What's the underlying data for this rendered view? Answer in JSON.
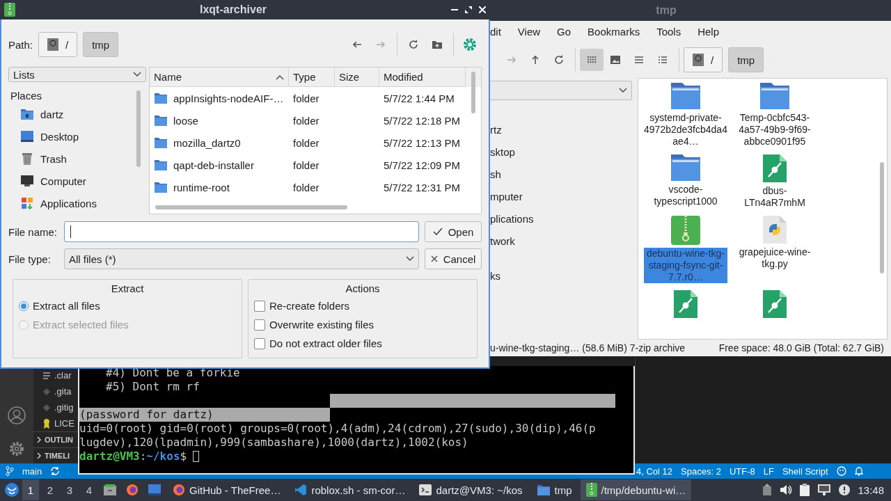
{
  "vscode": {
    "explorer": [
      {
        "label": ".clar",
        "kind": "lines"
      },
      {
        "label": ".gita",
        "kind": "git"
      },
      {
        "label": ".gitig",
        "kind": "git"
      },
      {
        "label": "LICE",
        "kind": "license"
      }
    ],
    "sections": [
      {
        "label": "OUTLIN",
        "expanded": false
      },
      {
        "label": "TIMELI",
        "expanded": false
      }
    ],
    "branch": "main",
    "status_right": [
      "4, Col 12",
      "Spaces: 2",
      "UTF-8",
      "LF",
      "Shell Script"
    ]
  },
  "file_manager": {
    "title": "tmp",
    "menu": [
      "dit",
      "View",
      "Go",
      "Bookmarks",
      "Tools",
      "Help"
    ],
    "nav": [
      {
        "kind": "forward",
        "disabled": true
      },
      {
        "kind": "up",
        "disabled": false
      },
      {
        "kind": "refresh",
        "disabled": false
      }
    ],
    "views": [
      {
        "kind": "icons",
        "selected": true
      },
      {
        "kind": "thumbnails",
        "selected": false
      },
      {
        "kind": "compact",
        "selected": false
      },
      {
        "kind": "details",
        "selected": false
      }
    ],
    "path": [
      {
        "label": "/",
        "kind": "root",
        "selected": false
      },
      {
        "label": "tmp",
        "kind": "folder",
        "selected": true
      }
    ],
    "side_items": [
      "rtz",
      "sktop",
      "sh",
      "mputer",
      "plications",
      "twork",
      "ks"
    ],
    "files": [
      {
        "name": "systemd-private-4972b2de3fcb4da4ae4…",
        "kind": "folder",
        "selected": false
      },
      {
        "name": "Temp-0cbfc543-4a57-49b9-9f69-abbce0901f95",
        "kind": "folder",
        "selected": false
      },
      {
        "name": "vscode-typescript1000",
        "kind": "folder",
        "selected": false
      },
      {
        "name": "dbus-LTn4aR7mhM",
        "kind": "link",
        "selected": false
      },
      {
        "name": "debuntu-wine-tkg-staging-fsync-git-7.7.r0…",
        "kind": "archive",
        "selected": true
      },
      {
        "name": "grapejuice-wine-tkg.py",
        "kind": "python",
        "selected": false
      },
      {
        "kind": "link"
      },
      {
        "kind": "link"
      }
    ],
    "status": "u-wine-tkg-staging… (58.6 MiB) 7-zip archive",
    "free_space": "Free space: 48.0 GiB (Total: 62.7 GiB)"
  },
  "terminal": {
    "lines": [
      {
        "kind": "indented",
        "text": "#4) Dont be a forkie"
      },
      {
        "kind": "indented",
        "text": "#5) Dont rm rf"
      },
      {
        "kind": "selection_tail"
      },
      {
        "kind": "selected",
        "text": "(password for dartz)"
      },
      {
        "kind": "plain",
        "text": "uid=0(root) gid=0(root) groups=0(root),4(adm),24(cdrom),27(sudo),30(dip),46(p"
      },
      {
        "kind": "plain",
        "text": "lugdev),120(lpadmin),999(sambashare),1000(dartz),1002(kos)"
      },
      {
        "kind": "prompt",
        "user": "dartz@VM3",
        "separator": ":",
        "path": "~/kos",
        "symbol": "$"
      }
    ]
  },
  "archiver": {
    "title": "lxqt-archiver",
    "path_label": "Path:",
    "path": [
      {
        "label": "/",
        "kind": "root",
        "selected": false
      },
      {
        "label": "tmp",
        "kind": "folder",
        "selected": true
      }
    ],
    "nav": [
      {
        "kind": "back",
        "disabled": false
      },
      {
        "kind": "forward",
        "disabled": true
      },
      {
        "kind": "refresh",
        "disabled": false
      },
      {
        "kind": "new-folder",
        "disabled": false
      }
    ],
    "places_dropdown": "Lists",
    "places_header": "Places",
    "places": [
      {
        "label": "dartz",
        "kind": "home"
      },
      {
        "label": "Desktop",
        "kind": "desktop"
      },
      {
        "label": "Trash",
        "kind": "trash"
      },
      {
        "label": "Computer",
        "kind": "computer"
      },
      {
        "label": "Applications",
        "kind": "applications"
      }
    ],
    "columns": [
      {
        "label": "Name",
        "sorted": true
      },
      {
        "label": "Type",
        "sorted": false
      },
      {
        "label": "Size",
        "sorted": false
      },
      {
        "label": "Modified",
        "sorted": false
      }
    ],
    "rows": [
      {
        "name": "appInsights-nodeAIF-…",
        "type": "folder",
        "modified": "5/7/22 1:44 PM"
      },
      {
        "name": "loose",
        "type": "folder",
        "modified": "5/7/22 12:18 PM"
      },
      {
        "name": "mozilla_dartz0",
        "type": "folder",
        "modified": "5/7/22 12:13 PM"
      },
      {
        "name": "qapt-deb-installer",
        "type": "folder",
        "modified": "5/7/22 12:09 PM"
      },
      {
        "name": "runtime-root",
        "type": "folder",
        "modified": "5/7/22 12:31 PM"
      }
    ],
    "file_name_label": "File name:",
    "file_type_label": "File type:",
    "file_type": "All files (*)",
    "open_button": "Open",
    "cancel_button": "Cancel",
    "extract": {
      "title": "Extract",
      "options": [
        {
          "label": "Extract all files",
          "selected": true,
          "disabled": false
        },
        {
          "label": "Extract selected files",
          "selected": false,
          "disabled": true
        }
      ]
    },
    "actions": {
      "title": "Actions",
      "options": [
        {
          "label": "Re-create folders",
          "checked": false
        },
        {
          "label": "Overwrite existing files",
          "checked": false
        },
        {
          "label": "Do not extract older files",
          "checked": false
        }
      ]
    }
  },
  "taskbar": {
    "desktops": [
      {
        "label": "1",
        "selected": true
      },
      {
        "label": "2",
        "selected": false
      },
      {
        "label": "3",
        "selected": false
      },
      {
        "label": "4",
        "selected": false
      }
    ],
    "tasks": [
      {
        "label": "GitHub - TheFree…",
        "kind": "firefox",
        "selected": false
      },
      {
        "label": "roblox.sh - sm-cor…",
        "kind": "vscode",
        "selected": false
      },
      {
        "label": "dartz@VM3: ~/kos",
        "kind": "terminal",
        "selected": false
      },
      {
        "label": "tmp",
        "kind": "folder",
        "selected": false
      },
      {
        "label": "/tmp/debuntu-wi…",
        "kind": "archive",
        "selected": true
      }
    ],
    "clock": "13:48"
  }
}
